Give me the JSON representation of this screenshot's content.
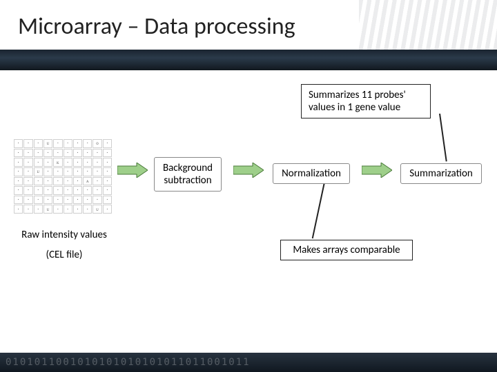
{
  "title": "Microarray – Data processing",
  "callout_summarize": "Summarizes 11 probes' values in 1 gene value",
  "callout_comparable": "Makes arrays comparable",
  "steps": {
    "bg_sub": "Background subtraction",
    "norm": "Normalization",
    "sum": "Summarization"
  },
  "raw_label_line1": "Raw intensity values",
  "raw_label_line2": "(CEL file)",
  "footer_deco": "0101011001010101010101011011001011",
  "microarray_glyphs": [
    "·",
    "·",
    "·",
    "ᴜ",
    "·",
    "·",
    "·",
    "·",
    "ᴏ",
    "·",
    "·",
    "·",
    "·",
    "·",
    "·",
    "·",
    "·",
    "·",
    "·",
    "·",
    "·",
    "·",
    "·",
    "·",
    "ᴋ",
    "·",
    "·",
    "·",
    "·",
    "·",
    "·",
    "·",
    "ᴜ",
    "·",
    "·",
    "·",
    "·",
    "·",
    "·",
    "·",
    "·",
    "·",
    "·",
    "·",
    "·",
    "·",
    "·",
    "ᴀ",
    "·",
    "·",
    "·",
    "·",
    "·",
    "·",
    "·",
    "·",
    "·",
    "·",
    "·",
    "·",
    "·",
    "·",
    "·",
    "·",
    "·",
    "·",
    "·",
    "·",
    "·",
    "·",
    "·",
    "·",
    "·",
    "ᴜ",
    "·",
    "·",
    "·",
    "·",
    "ᴜ",
    "·"
  ]
}
